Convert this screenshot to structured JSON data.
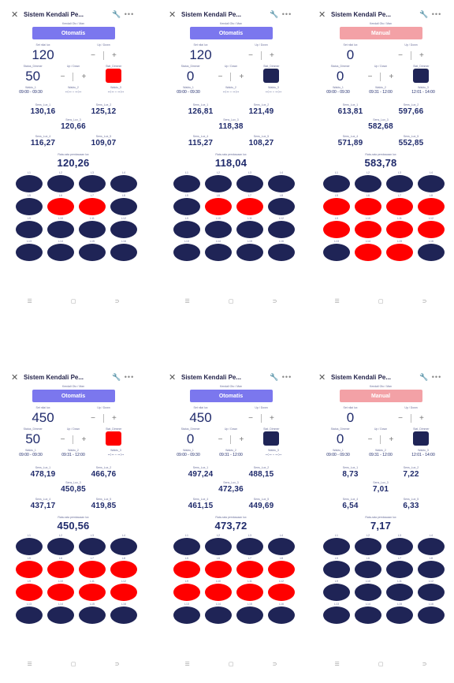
{
  "panels": [
    {
      "title": "Sistem Kendali Pe...",
      "mode_caption": "Kendali Oto / Man",
      "mode": "Otomatis",
      "mode_type": "auto",
      "set_caption": "Set nilai lux",
      "set_value": "120",
      "updown_caption": "Up / Down",
      "status_caption": "Status_Dimmer",
      "status_value": "50",
      "updown2_caption": "Up / Down",
      "stat_caption": "Stat_Dimmer",
      "stat_color": "#ff0000",
      "w1_caption": "Waktu_1",
      "w1": "09:00 - 09:30",
      "w2_caption": "Waktu_2",
      "w2": "--:-- - --:--",
      "w3_caption": "Waktu_3",
      "w3": "--:-- - --:--",
      "s1_caption": "Sens_Lux_1",
      "s1": "130,16",
      "s2_caption": "Sens_Lux_2",
      "s2": "125,12",
      "s3_caption": "Sens_Lux_3",
      "s3": "120,66",
      "s4_caption": "Sens_Lux_4",
      "s4": "116,27",
      "s5_caption": "Sens_Lux_5",
      "s5": "109,07",
      "avg_caption": "Rata-rata pembacaan lux",
      "avg": "120,26",
      "lamps": [
        "n",
        "n",
        "n",
        "n",
        "n",
        "r",
        "r",
        "n",
        "n",
        "n",
        "n",
        "n",
        "n",
        "n",
        "n",
        "n"
      ],
      "lamp_labels": [
        "L1",
        "L2",
        "L3",
        "L4",
        "L5",
        "L6",
        "L7",
        "L8",
        "L9",
        "L10",
        "L11",
        "L12",
        "L13",
        "L14",
        "L15",
        "L16"
      ]
    },
    {
      "title": "Sistem Kendali Pe...",
      "mode_caption": "Kendali Oto / Man",
      "mode": "Otomatis",
      "mode_type": "auto",
      "set_caption": "Set nilai lux",
      "set_value": "120",
      "updown_caption": "Up / Down",
      "status_caption": "Status_Dimmer",
      "status_value": "0",
      "updown2_caption": "Up / Down",
      "stat_caption": "Stat_Dimmer",
      "stat_color": "#1f2456",
      "w1_caption": "Waktu_1",
      "w1": "09:00 - 09:30",
      "w2_caption": "Waktu_2",
      "w2": "--:-- - --:--",
      "w3_caption": "Waktu_3",
      "w3": "--:-- - --:--",
      "s1_caption": "Sens_Lux_1",
      "s1": "126,81",
      "s2_caption": "Sens_Lux_2",
      "s2": "121,49",
      "s3_caption": "Sens_Lux_3",
      "s3": "118,38",
      "s4_caption": "Sens_Lux_4",
      "s4": "115,27",
      "s5_caption": "Sens_Lux_5",
      "s5": "108,27",
      "avg_caption": "Rata-rata pembacaan lux",
      "avg": "118,04",
      "lamps": [
        "n",
        "n",
        "n",
        "n",
        "n",
        "r",
        "r",
        "n",
        "n",
        "n",
        "n",
        "n",
        "n",
        "n",
        "n",
        "n"
      ],
      "lamp_labels": [
        "L1",
        "L2",
        "L3",
        "L4",
        "L5",
        "L6",
        "L7",
        "L8",
        "L9",
        "L10",
        "L11",
        "L12",
        "L13",
        "L14",
        "L15",
        "L16"
      ]
    },
    {
      "title": "Sistem Kendali Pe...",
      "mode_caption": "Kendali Oto / Man",
      "mode": "Manual",
      "mode_type": "man",
      "set_caption": "Set nilai lux",
      "set_value": "0",
      "updown_caption": "Up / Down",
      "status_caption": "Status_Dimmer",
      "status_value": "0",
      "updown2_caption": "Up / Down",
      "stat_caption": "Stat_Dimmer",
      "stat_color": "#1f2456",
      "w1_caption": "Waktu_1",
      "w1": "09:00 - 09:30",
      "w2_caption": "Waktu_2",
      "w2": "09:31 - 12:00",
      "w3_caption": "Waktu_3",
      "w3": "12:01 - 14:00",
      "s1_caption": "Sens_Lux_1",
      "s1": "613,81",
      "s2_caption": "Sens_Lux_2",
      "s2": "597,66",
      "s3_caption": "Sens_Lux_3",
      "s3": "582,68",
      "s4_caption": "Sens_Lux_4",
      "s4": "571,89",
      "s5_caption": "Sens_Lux_5",
      "s5": "552,85",
      "avg_caption": "Rata-rata pembacaan lux",
      "avg": "583,78",
      "lamps": [
        "n",
        "n",
        "n",
        "n",
        "r",
        "r",
        "r",
        "r",
        "r",
        "r",
        "r",
        "r",
        "n",
        "r",
        "r",
        "n"
      ],
      "lamp_labels": [
        "L1",
        "L2",
        "L3",
        "L4",
        "L5",
        "L6",
        "L7",
        "L8",
        "L9",
        "L10",
        "L11",
        "L12",
        "L13",
        "L14",
        "L15",
        "L16"
      ]
    },
    {
      "title": "Sistem Kendali Pe...",
      "mode_caption": "Kendali Oto / Man",
      "mode": "Otomatis",
      "mode_type": "auto",
      "set_caption": "Set nilai lux",
      "set_value": "450",
      "updown_caption": "Up / Down",
      "status_caption": "Status_Dimmer",
      "status_value": "50",
      "updown2_caption": "Up / Down",
      "stat_caption": "Stat_Dimmer",
      "stat_color": "#ff0000",
      "w1_caption": "Waktu_1",
      "w1": "09:00 - 09:30",
      "w2_caption": "Waktu_2",
      "w2": "09:31 - 12:00",
      "w3_caption": "Waktu_3",
      "w3": "--:-- - --:--",
      "s1_caption": "Sens_Lux_1",
      "s1": "478,19",
      "s2_caption": "Sens_Lux_2",
      "s2": "466,76",
      "s3_caption": "Sens_Lux_3",
      "s3": "450,85",
      "s4_caption": "Sens_Lux_4",
      "s4": "437,17",
      "s5_caption": "Sens_Lux_5",
      "s5": "419,85",
      "avg_caption": "Rata-rata pembacaan lux",
      "avg": "450,56",
      "lamps": [
        "n",
        "n",
        "n",
        "n",
        "r",
        "r",
        "r",
        "r",
        "r",
        "r",
        "r",
        "r",
        "n",
        "n",
        "n",
        "n"
      ],
      "lamp_labels": [
        "L1",
        "L2",
        "L3",
        "L4",
        "L5",
        "L6",
        "L7",
        "L8",
        "L9",
        "L10",
        "L11",
        "L12",
        "L13",
        "L14",
        "L15",
        "L16"
      ]
    },
    {
      "title": "Sistem Kendali Pe...",
      "mode_caption": "Kendali Oto / Man",
      "mode": "Otomatis",
      "mode_type": "auto",
      "set_caption": "Set nilai lux",
      "set_value": "450",
      "updown_caption": "Up / Down",
      "status_caption": "Status_Dimmer",
      "status_value": "0",
      "updown2_caption": "Up / Down",
      "stat_caption": "Stat_Dimmer",
      "stat_color": "#1f2456",
      "w1_caption": "Waktu_1",
      "w1": "09:00 - 09:30",
      "w2_caption": "Waktu_2",
      "w2": "09:31 - 12:00",
      "w3_caption": "Waktu_3",
      "w3": "--:-- - --:--",
      "s1_caption": "Sens_Lux_1",
      "s1": "497,24",
      "s2_caption": "Sens_Lux_2",
      "s2": "488,15",
      "s3_caption": "Sens_Lux_3",
      "s3": "472,36",
      "s4_caption": "Sens_Lux_4",
      "s4": "461,15",
      "s5_caption": "Sens_Lux_5",
      "s5": "449,69",
      "avg_caption": "Rata-rata pembacaan lux",
      "avg": "473,72",
      "lamps": [
        "n",
        "n",
        "n",
        "n",
        "r",
        "r",
        "r",
        "r",
        "r",
        "r",
        "r",
        "r",
        "n",
        "n",
        "n",
        "n"
      ],
      "lamp_labels": [
        "L1",
        "L2",
        "L3",
        "L4",
        "L5",
        "L6",
        "L7",
        "L8",
        "L9",
        "L10",
        "L11",
        "L12",
        "L13",
        "L14",
        "L15",
        "L16"
      ]
    },
    {
      "title": "Sistem Kendali Pe...",
      "mode_caption": "Kendali Oto / Man",
      "mode": "Manual",
      "mode_type": "man",
      "set_caption": "Set nilai lux",
      "set_value": "0",
      "updown_caption": "Up / Down",
      "status_caption": "Status_Dimmer",
      "status_value": "0",
      "updown2_caption": "Up / Down",
      "stat_caption": "Stat_Dimmer",
      "stat_color": "#1f2456",
      "w1_caption": "Waktu_1",
      "w1": "09:00 - 09:30",
      "w2_caption": "Waktu_2",
      "w2": "09:31 - 12:00",
      "w3_caption": "Waktu_3",
      "w3": "12:01 - 14:00",
      "s1_caption": "Sens_Lux_1",
      "s1": "8,73",
      "s2_caption": "Sens_Lux_2",
      "s2": "7,22",
      "s3_caption": "Sens_Lux_3",
      "s3": "7,01",
      "s4_caption": "Sens_Lux_4",
      "s4": "6,54",
      "s5_caption": "Sens_Lux_5",
      "s5": "6,33",
      "avg_caption": "Rata-rata pembacaan lux",
      "avg": "7,17",
      "lamps": [
        "n",
        "n",
        "n",
        "n",
        "n",
        "n",
        "n",
        "n",
        "n",
        "n",
        "n",
        "n",
        "n",
        "n",
        "n",
        "n"
      ],
      "lamp_labels": [
        "L1",
        "L2",
        "L3",
        "L4",
        "L5",
        "L6",
        "L7",
        "L8",
        "L9",
        "L10",
        "L11",
        "L12",
        "L13",
        "L14",
        "L15",
        "L16"
      ]
    }
  ],
  "icons": {
    "close": "close-icon",
    "wrench": "wrench-icon",
    "more": "more-icon"
  },
  "colors": {
    "auto_button": "#7b77ee",
    "manual_button": "#f3a1a6",
    "lamp_on": "#ff0000",
    "lamp_off": "#1f2456"
  }
}
